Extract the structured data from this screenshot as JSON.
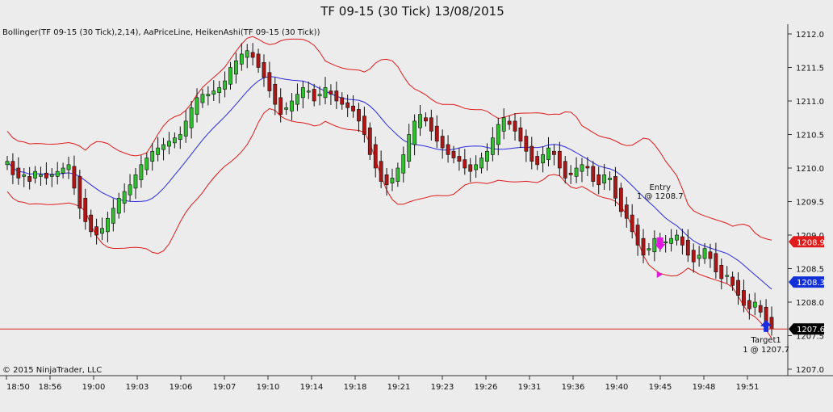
{
  "chart_data": {
    "type": "candlestick",
    "title": "TF 09-15 (30 Tick)  13/08/2015",
    "indicator_label": "Bollinger(TF 09-15 (30 Tick),2,14), AaPriceLine, HeikenAshi(TF 09-15 (30 Tick))",
    "copyright": "© 2015 NinjaTrader, LLC",
    "ylim": [
      1207.0,
      1212.0
    ],
    "y_ticks": [
      "1212.0",
      "1211.5",
      "1211.0",
      "1210.5",
      "1210.0",
      "1209.5",
      "1209.0",
      "1208.5",
      "1208.0",
      "1207.5",
      "1207.0"
    ],
    "x_ticks": [
      "18:50",
      "18:56",
      "19:00",
      "19:03",
      "19:06",
      "19:07",
      "19:10",
      "19:14",
      "19:18",
      "19:21",
      "19:23",
      "19:26",
      "19:31",
      "19:36",
      "19:40",
      "19:45",
      "19:48",
      "19:51"
    ],
    "price_line": 1207.6,
    "price_badges": [
      {
        "label": "1208.9",
        "value": 1208.9,
        "color": "#e01b1b"
      },
      {
        "label": "1208.3",
        "value": 1208.3,
        "color": "#1230d8"
      },
      {
        "label": "1207.6",
        "value": 1207.6,
        "color": "#000000"
      }
    ],
    "colors": {
      "up": "#2fbf2f",
      "down": "#b01515",
      "bands": "#e01b1b",
      "middle": "#2a2ae0",
      "price_line": "#d42020",
      "entry": "#e018e0",
      "target": "#1a2ee0",
      "background": "#ececec"
    },
    "closes": [
      1210.1,
      1209.9,
      1209.85,
      1209.9,
      1209.8,
      1209.95,
      1209.9,
      1209.85,
      1209.9,
      1209.95,
      1210.0,
      1210.05,
      1209.7,
      1209.4,
      1209.2,
      1209.05,
      1209.0,
      1209.1,
      1209.25,
      1209.4,
      1209.55,
      1209.65,
      1209.75,
      1209.9,
      1210.05,
      1210.15,
      1210.25,
      1210.3,
      1210.35,
      1210.4,
      1210.45,
      1210.5,
      1210.7,
      1210.9,
      1211.05,
      1211.1,
      1211.1,
      1211.15,
      1211.2,
      1211.3,
      1211.5,
      1211.6,
      1211.7,
      1211.75,
      1211.65,
      1211.5,
      1211.35,
      1211.15,
      1210.95,
      1210.8,
      1210.9,
      1211.0,
      1211.1,
      1211.2,
      1211.15,
      1211.0,
      1211.1,
      1211.2,
      1211.1,
      1211.0,
      1210.95,
      1210.9,
      1210.85,
      1210.7,
      1210.5,
      1210.2,
      1210.0,
      1209.8,
      1209.75,
      1209.85,
      1210.0,
      1210.2,
      1210.5,
      1210.7,
      1210.8,
      1210.7,
      1210.55,
      1210.4,
      1210.3,
      1210.2,
      1210.15,
      1210.1,
      1210.0,
      1209.95,
      1210.05,
      1210.15,
      1210.25,
      1210.45,
      1210.65,
      1210.75,
      1210.65,
      1210.55,
      1210.4,
      1210.25,
      1210.1,
      1210.05,
      1210.2,
      1210.3,
      1210.2,
      1210.0,
      1209.85,
      1209.9,
      1210.0,
      1210.05,
      1210.0,
      1209.8,
      1209.75,
      1209.9,
      1209.85,
      1209.55,
      1209.35,
      1209.25,
      1209.05,
      1208.85,
      1208.7,
      1208.8,
      1208.95,
      1208.85,
      1208.9,
      1208.95,
      1209.0,
      1208.85,
      1208.7,
      1208.6,
      1208.7,
      1208.8,
      1208.65,
      1208.45,
      1208.35,
      1208.4,
      1208.25,
      1208.1,
      1207.95,
      1207.9,
      1208.0,
      1207.85,
      1207.7,
      1207.6
    ],
    "annotations": {
      "entry": {
        "label": "Entry",
        "detail": "1 @ 1208.7",
        "bar": 117,
        "value": 1208.7
      },
      "target": {
        "label": "Target1",
        "detail": "1 @ 1207.7",
        "bar": 136,
        "value": 1207.7
      }
    }
  }
}
